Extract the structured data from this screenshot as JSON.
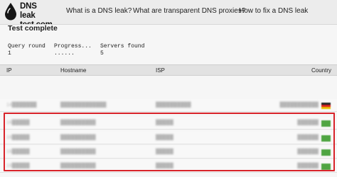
{
  "brand": {
    "line1": "DNS leak",
    "line2": "test.com"
  },
  "nav": [
    {
      "label": "What is a DNS leak?"
    },
    {
      "label": "What are transparent DNS proxies?"
    },
    {
      "label": "How to fix a DNS leak"
    }
  ],
  "main": {
    "title": "Test complete",
    "stats": [
      {
        "label": "Query round",
        "value": "1"
      },
      {
        "label": "Progress...",
        "value": "......"
      },
      {
        "label": "Servers found",
        "value": "5"
      }
    ]
  },
  "table": {
    "headers": {
      "ip": "IP",
      "hostname": "Hostname",
      "isp": "ISP",
      "country": "Country"
    },
    "rows": [
      {
        "ip": "14███████",
        "hostname": "█████████████",
        "isp": "██████████",
        "country": "███████████",
        "flag": "de-flag-icon"
      },
      {
        "ip": "16█████",
        "hostname": "██████████",
        "isp": "█████",
        "country": "██████",
        "flag": "green-flag-icon"
      },
      {
        "ip": "16█████",
        "hostname": "██████████",
        "isp": "█████",
        "country": "██████",
        "flag": "green-flag-icon"
      },
      {
        "ip": "16█████",
        "hostname": "██████████",
        "isp": "█████",
        "country": "██████",
        "flag": "green-flag-icon"
      },
      {
        "ip": "16█████",
        "hostname": "██████████",
        "isp": "█████",
        "country": "██████",
        "flag": "green-flag-icon"
      }
    ]
  },
  "colors": {
    "highlight": "#d8232a",
    "flag_green": "#4fa542",
    "header_bg": "#ececec"
  }
}
